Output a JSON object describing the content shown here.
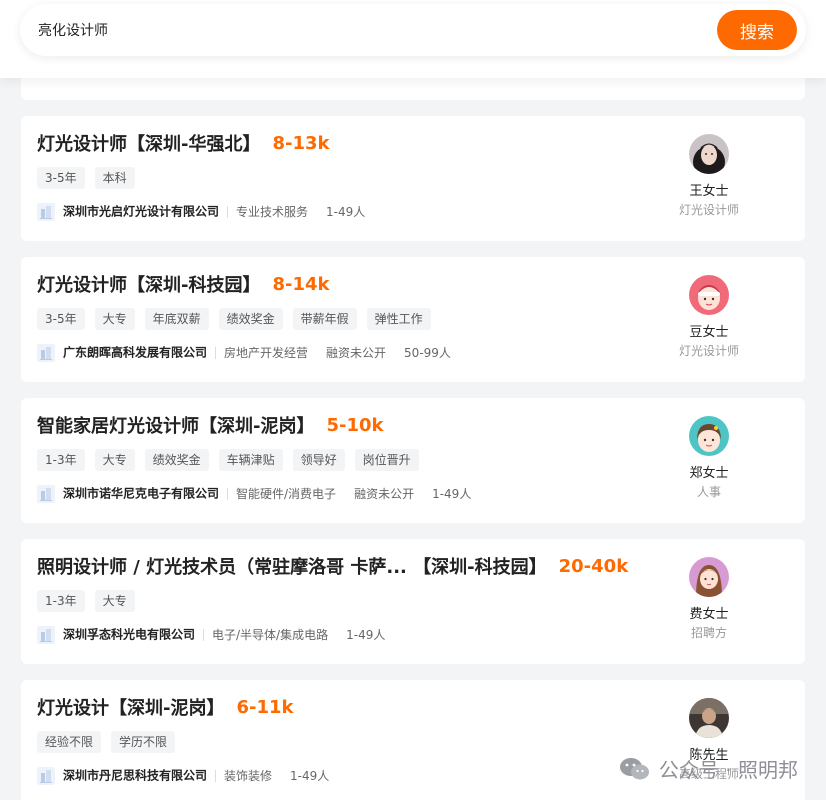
{
  "search": {
    "query": "亮化设计师",
    "button_label": "搜索"
  },
  "jobs": [
    {
      "title": "灯光设计师【深圳-华强北】",
      "salary": "8-13k",
      "tags": [
        "3-5年",
        "本科"
      ],
      "company": {
        "name": "深圳市光启灯光设计有限公司",
        "meta": [
          "专业技术服务",
          "1-49人"
        ]
      },
      "recruiter": {
        "name": "王女士",
        "role": "灯光设计师",
        "avatar": "avatar-dark-hair"
      }
    },
    {
      "title": "灯光设计师【深圳-科技园】",
      "salary": "8-14k",
      "tags": [
        "3-5年",
        "大专",
        "年底双薪",
        "绩效奖金",
        "带薪年假",
        "弹性工作"
      ],
      "company": {
        "name": "广东朗晖高科发展有限公司",
        "meta": [
          "房地产开发经营",
          "融资未公开",
          "50-99人"
        ]
      },
      "recruiter": {
        "name": "豆女士",
        "role": "灯光设计师",
        "avatar": "avatar-cartoon-red"
      }
    },
    {
      "title": "智能家居灯光设计师【深圳-泥岗】",
      "salary": "5-10k",
      "tags": [
        "1-3年",
        "大专",
        "绩效奖金",
        "车辆津贴",
        "领导好",
        "岗位晋升"
      ],
      "company": {
        "name": "深圳市诺华尼克电子有限公司",
        "meta": [
          "智能硬件/消费电子",
          "融资未公开",
          "1-49人"
        ]
      },
      "recruiter": {
        "name": "郑女士",
        "role": "人事",
        "avatar": "avatar-cartoon-teal"
      }
    },
    {
      "title": "照明设计师 / 灯光技术员（常驻摩洛哥 卡萨... 【深圳-科技园】",
      "salary": "20-40k",
      "tags": [
        "1-3年",
        "大专"
      ],
      "company": {
        "name": "深圳孚态科光电有限公司",
        "meta": [
          "电子/半导体/集成电路",
          "1-49人"
        ]
      },
      "recruiter": {
        "name": "费女士",
        "role": "招聘方",
        "avatar": "avatar-cartoon-pink"
      }
    },
    {
      "title": "灯光设计【深圳-泥岗】",
      "salary": "6-11k",
      "tags": [
        "经验不限",
        "学历不限"
      ],
      "company": {
        "name": "深圳市丹尼思科技有限公司",
        "meta": [
          "装饰装修",
          "1-49人"
        ]
      },
      "recruiter": {
        "name": "陈先生",
        "role": "高级工程师",
        "avatar": "avatar-photo-man"
      }
    }
  ],
  "watermark": {
    "text": "公众号 · 照明邦"
  },
  "colors": {
    "accent": "#ff6a00",
    "background": "#f3f4f6",
    "card": "#ffffff"
  }
}
